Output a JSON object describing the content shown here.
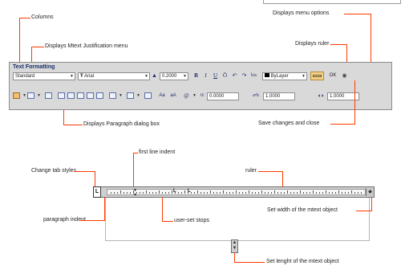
{
  "toolbar": {
    "title": "Text Formatting",
    "style_value": "Standard",
    "font_value": "Arial",
    "height_value": "0.2000",
    "bold": "B",
    "italic": "I",
    "underline": "U",
    "overline": "Ō",
    "color_value": "ByLayer",
    "ok_label": "OK",
    "case_upper": "Aa",
    "case_lower": "aA",
    "symbol": "@",
    "oblique_value": "0.0000",
    "tracking_value": "1.0000",
    "width_value": "1.0000"
  },
  "annotations": {
    "columns": "Columns",
    "justification": "Displays Mtext Justification menu",
    "menu_options": "Displays menu options",
    "ruler_toggle": "Displays ruler",
    "paragraph": "Displays Paragraph dialog box",
    "save_close": "Save changes and close",
    "first_line_indent": "first line indent",
    "change_tab": "Change tab styles",
    "ruler": "ruler",
    "paragraph_indent": "paragraph indent",
    "user_set_stops": "user-set stops",
    "set_width": "Set width of the mtext object",
    "set_length": "Set lenght of the mtext object"
  },
  "colors": {
    "callout": "#ff3b00",
    "toolbar_bg": "#d9d9d9",
    "title": "#1b2d6b"
  }
}
